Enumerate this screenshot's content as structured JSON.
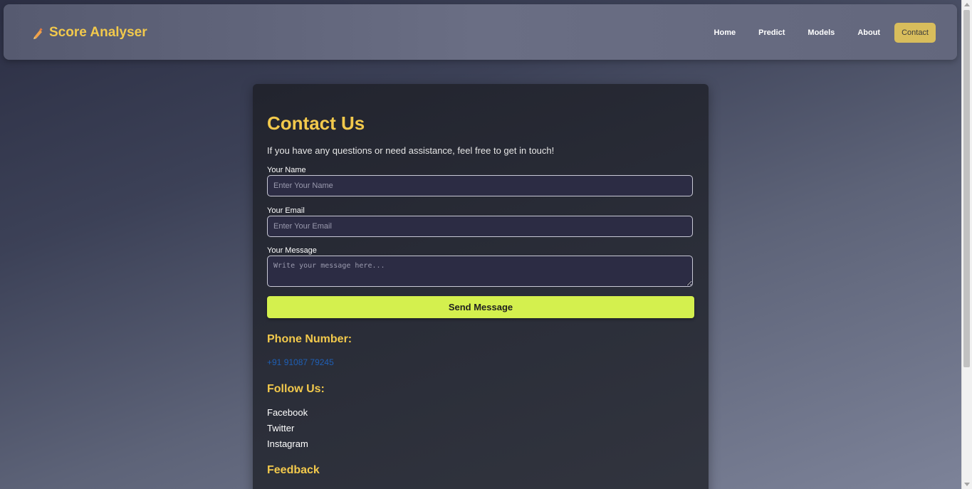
{
  "brand": {
    "title": "Score Analyser",
    "icon": "pencil-icon"
  },
  "nav": {
    "items": [
      {
        "label": "Home"
      },
      {
        "label": "Predict"
      },
      {
        "label": "Models"
      },
      {
        "label": "About"
      },
      {
        "label": "Contact",
        "active": true
      }
    ]
  },
  "contact": {
    "title": "Contact Us",
    "intro": "If you have any questions or need assistance, feel free to get in touch!",
    "name_label": "Your Name",
    "name_placeholder": "Enter Your Name",
    "email_label": "Your Email",
    "email_placeholder": "Enter Your Email",
    "message_label": "Your Message",
    "message_placeholder": "Write your message here...",
    "send_label": "Send Message",
    "phone_heading": "Phone Number:",
    "phone_value": "+91 91087 79245",
    "follow_heading": "Follow Us:",
    "social": [
      "Facebook",
      "Twitter",
      "Instagram"
    ],
    "feedback_heading": "Feedback"
  },
  "colors": {
    "accent": "#f2c94c",
    "button": "#d4f04e",
    "active_nav": "#d8bd5c",
    "link": "#1f5fb4"
  }
}
